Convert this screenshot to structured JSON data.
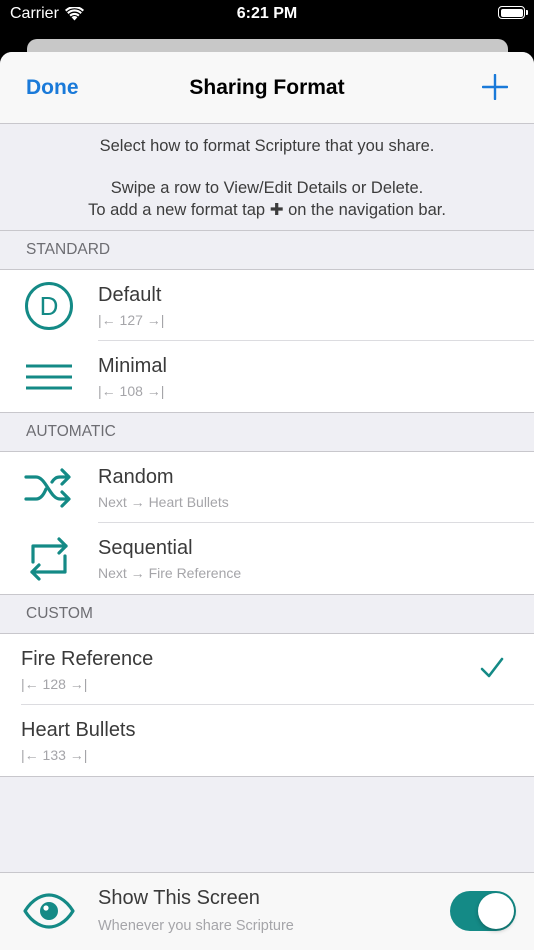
{
  "status_bar": {
    "carrier": "Carrier",
    "time": "6:21 PM",
    "battery_level": 1.0
  },
  "colors": {
    "accent_blue": "#1a7ad9",
    "teal": "#148a86"
  },
  "nav": {
    "done_label": "Done",
    "title": "Sharing Format",
    "add_icon": "plus-icon"
  },
  "info": {
    "line1": "Select how to format Scripture that you share.",
    "line2": "Swipe a row to View/Edit Details or Delete.",
    "line3_before": "To add a new format tap",
    "line3_glyph": "✚",
    "line3_after": "on the navigation bar."
  },
  "sections": {
    "standard": {
      "header": "STANDARD",
      "rows": [
        {
          "title": "Default",
          "subtitle": "|← 127 →|",
          "icon": "default-d-icon"
        },
        {
          "title": "Minimal",
          "subtitle": "|← 108 →|",
          "icon": "lines-icon"
        }
      ]
    },
    "automatic": {
      "header": "AUTOMATIC",
      "rows": [
        {
          "title": "Random",
          "subtitle": "Next → Heart Bullets",
          "icon": "shuffle-icon"
        },
        {
          "title": "Sequential",
          "subtitle": "Next → Fire Reference",
          "icon": "repeat-icon"
        }
      ]
    },
    "custom": {
      "header": "CUSTOM",
      "rows": [
        {
          "title": "Fire Reference",
          "subtitle": "|← 128 →|",
          "selected": true
        },
        {
          "title": "Heart Bullets",
          "subtitle": "|← 133 →|",
          "selected": false
        }
      ]
    }
  },
  "bottom": {
    "title": "Show This Screen",
    "subtitle": "Whenever you share Scripture",
    "toggle_on": true,
    "icon": "eye-icon"
  }
}
